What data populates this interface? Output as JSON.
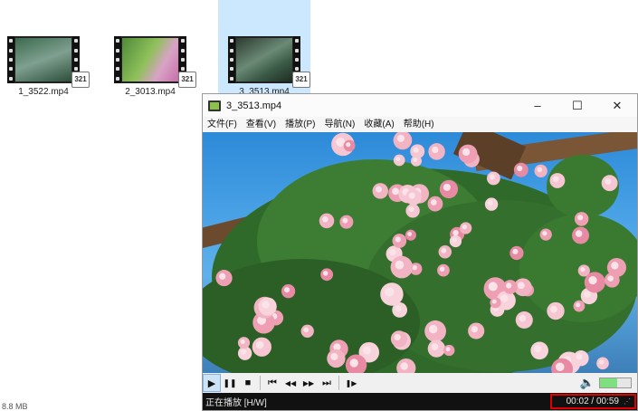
{
  "files": [
    {
      "name": "1_3522.mp4",
      "badge": "321",
      "selected": false
    },
    {
      "name": "2_3013.mp4",
      "badge": "321",
      "selected": false
    },
    {
      "name": "3_3513.mp4",
      "badge": "321",
      "selected": true
    }
  ],
  "explorer_status": "8.8 MB",
  "player": {
    "title": "3_3513.mp4",
    "window_buttons": {
      "minimize": "–",
      "maximize": "☐",
      "close": "✕"
    },
    "menu": [
      "文件(F)",
      "查看(V)",
      "播放(P)",
      "导航(N)",
      "收藏(A)",
      "帮助(H)"
    ],
    "controls": {
      "play": "▶",
      "pause": "❚❚",
      "stop": "■",
      "prev": "⏮",
      "rewind": "◀◀",
      "forward": "▶▶",
      "next": "⏭",
      "frame_step": "❚▶",
      "volume": "🔈"
    },
    "volume_level": 0.55,
    "status_text": "正在播放 [H/W]",
    "time": "00:02 / 00:59",
    "resize_grip": "⋰"
  },
  "colors": {
    "highlight": "#e00000",
    "selection": "#cce8ff",
    "volume_fill": "#7ee07e"
  }
}
